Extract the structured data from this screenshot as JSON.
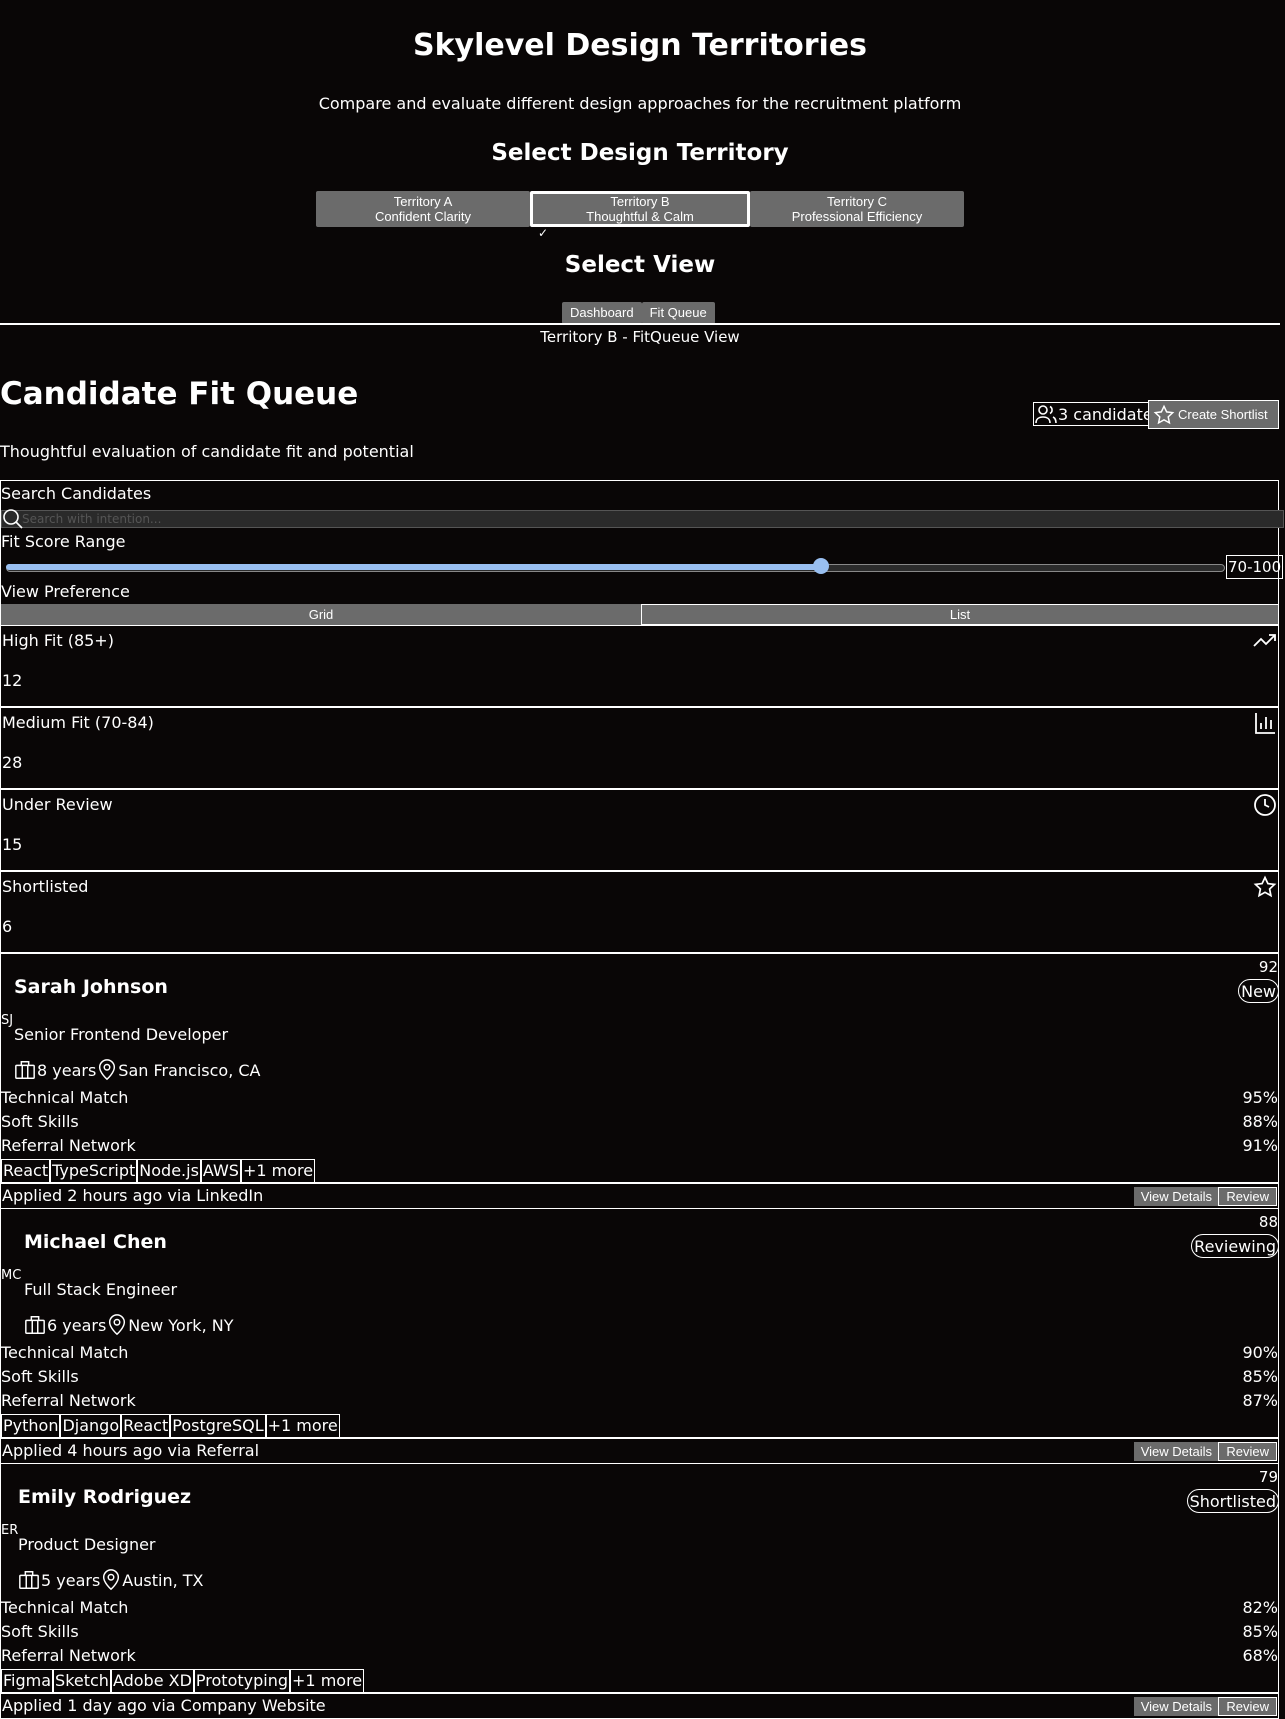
{
  "header": {
    "title": "Skylevel Design Territories",
    "subtitle": "Compare and evaluate different design approaches for the recruitment platform",
    "territory_heading": "Select Design Territory",
    "view_heading": "Select View"
  },
  "territories": [
    {
      "name": "Territory A",
      "desc": "Confident Clarity"
    },
    {
      "name": "Territory B",
      "desc": "Thoughtful & Calm"
    },
    {
      "name": "Territory C",
      "desc": "Professional Efficiency"
    }
  ],
  "active_check": "✓",
  "views": [
    "Dashboard",
    "Fit Queue"
  ],
  "view_caption": "Territory B - FitQueue View",
  "page": {
    "title": "Candidate Fit Queue",
    "description": "Thoughtful evaluation of candidate fit and potential",
    "candidate_count": "3 candidates",
    "create_shortlist": "Create Shortlist"
  },
  "filters": {
    "search_label": "Search Candidates",
    "search_placeholder": "Search with intention...",
    "range_label": "Fit Score Range",
    "range_value": "70-100",
    "range_fraction": 0.67,
    "view_pref_label": "View Preference",
    "view_grid": "Grid",
    "view_list": "List"
  },
  "stats": [
    {
      "label": "High Fit (85+)",
      "value": "12",
      "icon": "trending-up-icon"
    },
    {
      "label": "Medium Fit (70-84)",
      "value": "28",
      "icon": "bar-chart-icon"
    },
    {
      "label": "Under Review",
      "value": "15",
      "icon": "clock-icon"
    },
    {
      "label": "Shortlisted",
      "value": "6",
      "icon": "star-icon"
    }
  ],
  "candidates": [
    {
      "name": "Sarah Johnson",
      "initials": "SJ",
      "role": "Senior Frontend Developer",
      "years": "8 years",
      "location": "San Francisco, CA",
      "score": "92",
      "status": "New",
      "metrics": [
        {
          "label": "Technical Match",
          "value": "95%"
        },
        {
          "label": "Soft Skills",
          "value": "88%"
        },
        {
          "label": "Referral Network",
          "value": "91%"
        }
      ],
      "tags": [
        "React",
        "TypeScript",
        "Node.js",
        "AWS",
        "+1 more"
      ],
      "applied": "Applied 2 hours ago via LinkedIn"
    },
    {
      "name": "Michael Chen",
      "initials": "MC",
      "role": "Full Stack Engineer",
      "years": "6 years",
      "location": "New York, NY",
      "score": "88",
      "status": "Reviewing",
      "metrics": [
        {
          "label": "Technical Match",
          "value": "90%"
        },
        {
          "label": "Soft Skills",
          "value": "85%"
        },
        {
          "label": "Referral Network",
          "value": "87%"
        }
      ],
      "tags": [
        "Python",
        "Django",
        "React",
        "PostgreSQL",
        "+1 more"
      ],
      "applied": "Applied 4 hours ago via Referral"
    },
    {
      "name": "Emily Rodriguez",
      "initials": "ER",
      "role": "Product Designer",
      "years": "5 years",
      "location": "Austin, TX",
      "score": "79",
      "status": "Shortlisted",
      "metrics": [
        {
          "label": "Technical Match",
          "value": "82%"
        },
        {
          "label": "Soft Skills",
          "value": "85%"
        },
        {
          "label": "Referral Network",
          "value": "68%"
        }
      ],
      "tags": [
        "Figma",
        "Sketch",
        "Adobe XD",
        "Prototyping",
        "+1 more"
      ],
      "applied": "Applied 1 day ago via Company Website"
    }
  ],
  "card_actions": {
    "view_details": "View Details",
    "review": "Review"
  },
  "colors": {
    "background": "#090606",
    "button": "#6b6b6b",
    "slider": "#99bff0"
  }
}
